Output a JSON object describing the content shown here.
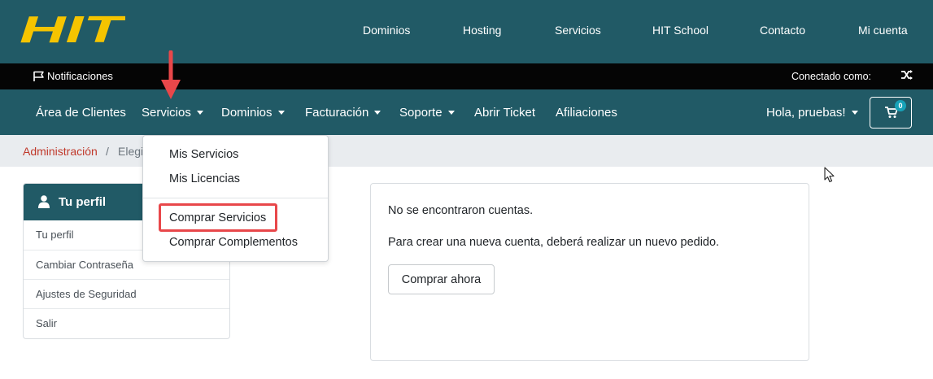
{
  "logo": {
    "text": "HIT",
    "color": "#f5c400"
  },
  "top_nav": [
    "Dominios",
    "Hosting",
    "Servicios",
    "HIT School",
    "Contacto",
    "Mi cuenta"
  ],
  "notification_bar": {
    "notifications_label": "Notificaciones",
    "connected_label": "Conectado como:"
  },
  "main_nav": {
    "items": [
      {
        "label": "Área de Clientes",
        "dropdown": false
      },
      {
        "label": "Servicios",
        "dropdown": true
      },
      {
        "label": "Dominios",
        "dropdown": true
      },
      {
        "label": "Facturación",
        "dropdown": true
      },
      {
        "label": "Soporte",
        "dropdown": true
      },
      {
        "label": "Abrir Ticket",
        "dropdown": false
      },
      {
        "label": "Afiliaciones",
        "dropdown": false
      }
    ],
    "greeting": "Hola, pruebas!",
    "cart_count": "0"
  },
  "breadcrumb": {
    "admin": "Administración",
    "separator": "/",
    "current": "Elegi"
  },
  "services_dropdown": {
    "items": [
      "Mis Servicios",
      "Mis Licencias",
      "Comprar Servicios",
      "Comprar Complementos"
    ],
    "highlighted": "Comprar Servicios"
  },
  "profile_card": {
    "title": "Tu perfil",
    "items": [
      "Tu perfil",
      "Cambiar Contraseña",
      "Ajustes de Seguridad",
      "Salir"
    ]
  },
  "accounts": {
    "no_accounts": "No se encontraron cuentas.",
    "instruction": "Para crear una nueva cuenta, deberá realizar un nuevo pedido.",
    "buy_button": "Comprar ahora"
  },
  "colors": {
    "primary": "#215a66",
    "accent": "#f5c400",
    "annotation": "#e8474a",
    "link": "#c0392b"
  }
}
